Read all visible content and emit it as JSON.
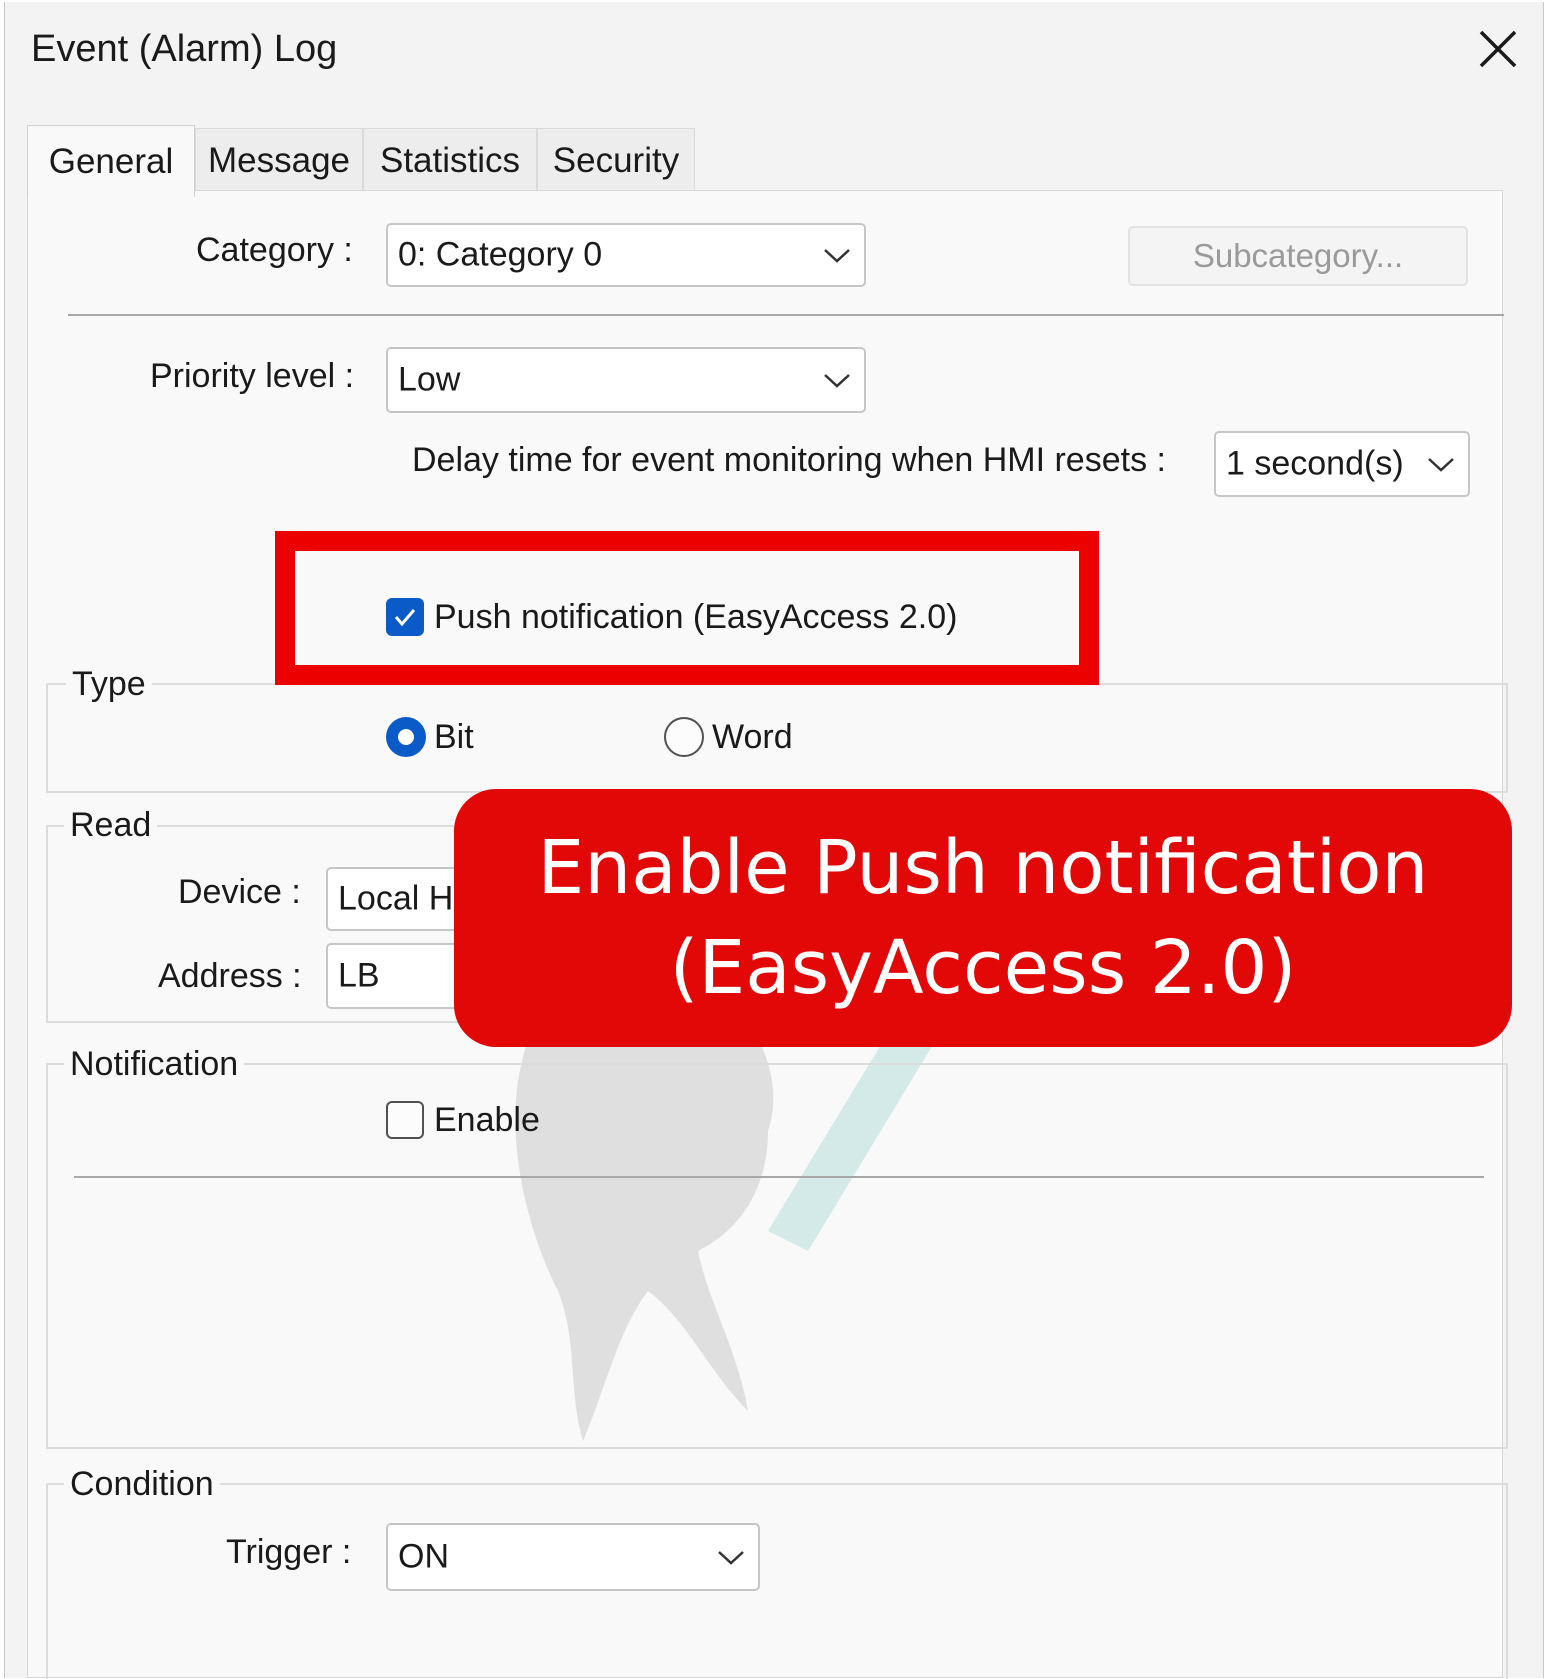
{
  "window": {
    "title": "Event (Alarm) Log"
  },
  "tabs": [
    {
      "label": "General",
      "active": true
    },
    {
      "label": "Message",
      "active": false
    },
    {
      "label": "Statistics",
      "active": false
    },
    {
      "label": "Security",
      "active": false
    }
  ],
  "general": {
    "category_label": "Category :",
    "category_value": "0: Category 0",
    "subcategory_button": "Subcategory...",
    "priority_label": "Priority level :",
    "priority_value": "Low",
    "delay_label": "Delay time for event monitoring when HMI resets :",
    "delay_value": "1 second(s)",
    "push_notification_label": "Push notification (EasyAccess 2.0)",
    "push_notification_checked": true
  },
  "type_group": {
    "title": "Type",
    "options": [
      {
        "label": "Bit",
        "selected": true
      },
      {
        "label": "Word",
        "selected": false
      }
    ]
  },
  "read_group": {
    "title": "Read",
    "device_label": "Device :",
    "device_value": "Local HM",
    "address_label": "Address :",
    "address_value": "LB"
  },
  "notification_group": {
    "title": "Notification",
    "enable_label": "Enable",
    "enable_checked": false
  },
  "condition_group": {
    "title": "Condition",
    "trigger_label": "Trigger :",
    "trigger_value": "ON"
  },
  "annotation": {
    "line1": "Enable Push notification",
    "line2": "(EasyAccess 2.0)",
    "highlight_color": "#ec0000",
    "callout_color": "#e20808"
  },
  "colors": {
    "accent": "#0a5bc7",
    "window_bg": "#f3f3f3",
    "panel_bg": "#f9f9f9"
  }
}
